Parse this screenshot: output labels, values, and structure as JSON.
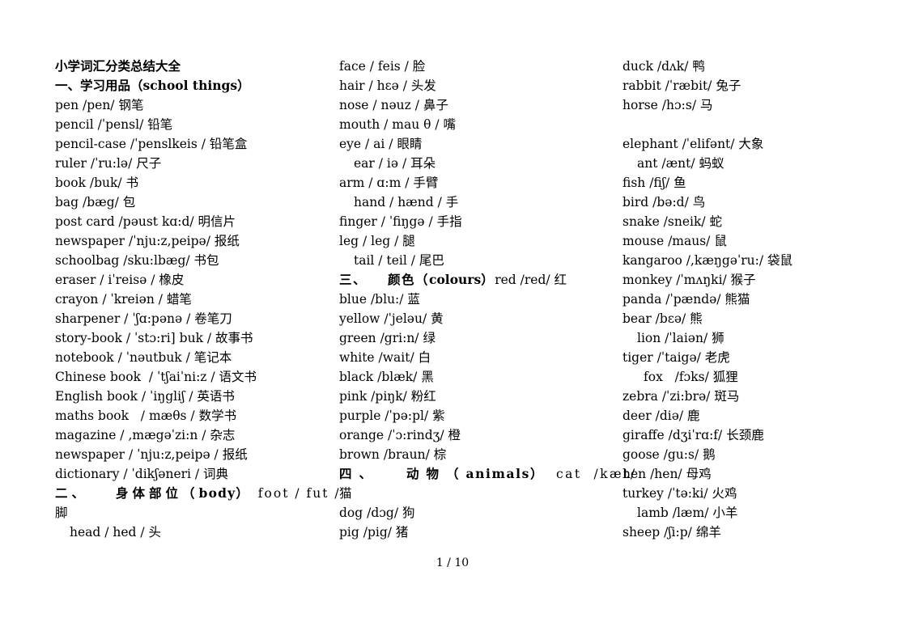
{
  "document": {
    "title": "小学词汇分类总结大全",
    "footer": "1 / 10"
  },
  "columns": [
    {
      "id": "column-1",
      "lines": [
        {
          "type": "doc-title",
          "text": "小学词汇分类总结大全"
        },
        {
          "type": "section",
          "cn": "一、学习用品（",
          "en": "school things",
          "close": "）",
          "track": "none"
        },
        {
          "type": "entry",
          "text": "pen /pen/ 钢笔"
        },
        {
          "type": "entry",
          "text": "pencil /ˈpensl/ 铅笔"
        },
        {
          "type": "entry",
          "text": "pencil-case /ˈpenslkeis / 铅笔盒"
        },
        {
          "type": "entry",
          "text": "ruler /ˈru:lə/ 尺子"
        },
        {
          "type": "entry",
          "text": "book /buk/ 书"
        },
        {
          "type": "entry",
          "text": "bag /bæg/ 包"
        },
        {
          "type": "entry",
          "text": "post card /pəust kɑ:d/ 明信片"
        },
        {
          "type": "entry",
          "text": "newspaper /ˈnju:z,peipə/ 报纸"
        },
        {
          "type": "entry",
          "text": "schoolbag /sku:lbæg/ 书包"
        },
        {
          "type": "entry",
          "text": "eraser / iˈreisə / 橡皮"
        },
        {
          "type": "entry",
          "text": "crayon / ˈkreiən / 蜡笔"
        },
        {
          "type": "entry",
          "text": "sharpener / ˈʃɑ:pənə / 卷笔刀"
        },
        {
          "type": "entry",
          "text": "story-book / ˈstɔ:ri] buk / 故事书"
        },
        {
          "type": "entry",
          "text": "notebook / ˈnəutbuk / 笔记本"
        },
        {
          "type": "entry",
          "text": "Chinese book  / ˈtʃaiˈni:z / 语文书"
        },
        {
          "type": "entry",
          "text": "English book / ˈiŋgliʃ / 英语书"
        },
        {
          "type": "entry",
          "text": "maths book   / mæθs / 数学书"
        },
        {
          "type": "entry",
          "text": "magazine / ,mægəˈzi:n / 杂志"
        },
        {
          "type": "entry",
          "text": "newspaper / ˈnju:z,peipə / 报纸"
        },
        {
          "type": "entry",
          "text": "dictionary / ˈdikʃəneri / 词典"
        },
        {
          "type": "section",
          "cn": "二、",
          "gap": "lg",
          "cn2": "身体部位（",
          "en": "body",
          "close": "）",
          "tail": " foot / fut /",
          "track": "md"
        },
        {
          "type": "entry",
          "text": "脚"
        },
        {
          "type": "entry",
          "indent": 1,
          "text": "head / hed / 头"
        }
      ]
    },
    {
      "id": "column-2",
      "lines": [
        {
          "type": "entry",
          "text": "face / feis / 脸"
        },
        {
          "type": "entry",
          "text": "hair / hɛə / 头发"
        },
        {
          "type": "entry",
          "text": "nose / nəuz / 鼻子"
        },
        {
          "type": "entry",
          "text": "mouth / mau θ / 嘴"
        },
        {
          "type": "entry",
          "text": "eye / ai / 眼睛"
        },
        {
          "type": "entry",
          "indent": 1,
          "text": "ear / iə / 耳朵"
        },
        {
          "type": "entry",
          "text": "arm / ɑ:m / 手臂"
        },
        {
          "type": "entry",
          "indent": 1,
          "text": "hand / hænd / 手"
        },
        {
          "type": "entry",
          "text": "finger / ˈfiŋgə / 手指"
        },
        {
          "type": "entry",
          "text": "leg / leg / 腿"
        },
        {
          "type": "entry",
          "indent": 1,
          "text": "tail / teil / 尾巴"
        },
        {
          "type": "section",
          "cn": "三、",
          "gap": "md",
          "cn2": "颜色（",
          "en": "colours",
          "close": "）",
          "tail": "red /red/ 红",
          "track": "sm"
        },
        {
          "type": "entry",
          "text": "blue /blu:/ 蓝"
        },
        {
          "type": "entry",
          "text": "yellow /ˈjeləu/ 黄"
        },
        {
          "type": "entry",
          "text": "green /gri:n/ 绿"
        },
        {
          "type": "entry",
          "text": "white /wait/ 白"
        },
        {
          "type": "entry",
          "text": "black /blæk/ 黑"
        },
        {
          "type": "entry",
          "text": "pink /piŋk/ 粉红"
        },
        {
          "type": "entry",
          "text": "purple /ˈpə:pl/ 紫"
        },
        {
          "type": "entry",
          "text": "orange /ˈɔ:rindʒ/ 橙"
        },
        {
          "type": "entry",
          "text": "brown /braun/ 棕"
        },
        {
          "type": "section",
          "cn": "四、",
          "gap": "lg",
          "cn2": "动物（",
          "en": "animals",
          "close": "）",
          "tail": " cat  /kæt/",
          "track": "lg"
        },
        {
          "type": "entry",
          "text": "猫"
        },
        {
          "type": "entry",
          "text": "dog /dɔg/ 狗"
        },
        {
          "type": "entry",
          "text": "pig /pig/ 猪"
        }
      ]
    },
    {
      "id": "column-3",
      "lines": [
        {
          "type": "entry",
          "text": "duck /dʌk/ 鸭"
        },
        {
          "type": "entry",
          "text": "rabbit /ˈræbit/ 兔子"
        },
        {
          "type": "entry",
          "text": "horse /hɔ:s/ 马"
        },
        {
          "type": "blank",
          "text": ""
        },
        {
          "type": "entry",
          "text": "elephant /ˈelifənt/ 大象"
        },
        {
          "type": "entry",
          "indent": 1,
          "text": "ant /ænt/ 蚂蚁"
        },
        {
          "type": "entry",
          "text": "fish /fiʃ/ 鱼"
        },
        {
          "type": "entry",
          "text": "bird /bə:d/ 鸟"
        },
        {
          "type": "entry",
          "text": "snake /sneik/ 蛇"
        },
        {
          "type": "entry",
          "text": "mouse /maus/ 鼠"
        },
        {
          "type": "entry",
          "text": "kangaroo /,kæŋgəˈru:/ 袋鼠"
        },
        {
          "type": "entry",
          "text": "monkey /ˈmʌŋki/ 猴子"
        },
        {
          "type": "entry",
          "text": "panda /ˈpændə/ 熊猫"
        },
        {
          "type": "entry",
          "text": "bear /bɛə/ 熊"
        },
        {
          "type": "entry",
          "indent": 1,
          "text": "lion /ˈlaiən/ 狮"
        },
        {
          "type": "entry",
          "text": "tiger /ˈtaigə/ 老虎"
        },
        {
          "type": "entry",
          "indent": 2,
          "text": "fox   /fɔks/ 狐狸"
        },
        {
          "type": "entry",
          "text": "zebra /ˈzi:brə/ 斑马"
        },
        {
          "type": "entry",
          "text": "deer /diə/ 鹿"
        },
        {
          "type": "entry",
          "text": "giraffe /dʒiˈrɑ:f/ 长颈鹿"
        },
        {
          "type": "entry",
          "text": "goose /gu:s/ 鹅"
        },
        {
          "type": "entry",
          "text": "hen /hen/ 母鸡"
        },
        {
          "type": "entry",
          "text": "turkey /ˈtə:ki/ 火鸡"
        },
        {
          "type": "entry",
          "indent": 1,
          "text": "lamb /læm/ 小羊"
        },
        {
          "type": "entry",
          "text": "sheep /ʃi:p/ 绵羊"
        }
      ]
    }
  ]
}
